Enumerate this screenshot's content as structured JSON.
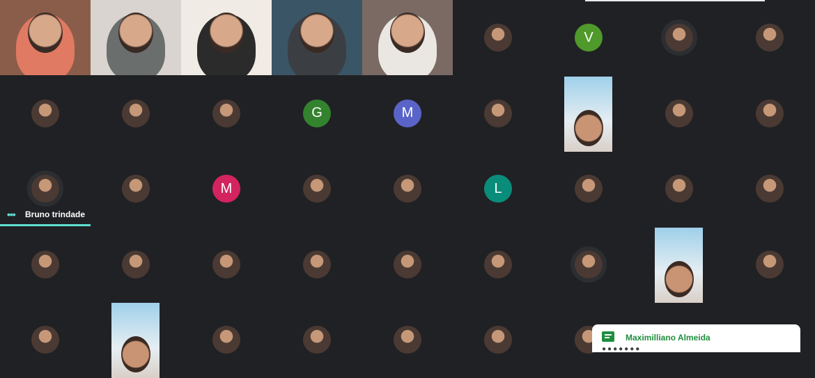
{
  "meeting": {
    "active_speaker": "Bruno trindade"
  },
  "video_tiles": [
    {
      "bg": "#8a5d4a",
      "shirt": "#e07a62"
    },
    {
      "bg": "#d9d4cf",
      "shirt": "#6a6f6e"
    },
    {
      "bg": "#f0ebe4",
      "shirt": "#2b2b2b"
    },
    {
      "bg": "#3a5566",
      "shirt": "#3b3f44"
    },
    {
      "bg": "#7a6a63",
      "shirt": "#eae7e2"
    }
  ],
  "participants": [
    {
      "row": 0,
      "col": 5,
      "kind": "photo"
    },
    {
      "row": 0,
      "col": 6,
      "kind": "letter",
      "initial": "V",
      "color": "#4f9a2b"
    },
    {
      "row": 0,
      "col": 7,
      "kind": "photo",
      "halo": true
    },
    {
      "row": 0,
      "col": 8,
      "kind": "photo"
    },
    {
      "row": 1,
      "col": 0,
      "kind": "photo"
    },
    {
      "row": 1,
      "col": 1,
      "kind": "photo"
    },
    {
      "row": 1,
      "col": 2,
      "kind": "photo"
    },
    {
      "row": 1,
      "col": 3,
      "kind": "letter",
      "initial": "G",
      "color": "#33822e"
    },
    {
      "row": 1,
      "col": 4,
      "kind": "letter",
      "initial": "M",
      "color": "#5a64c8"
    },
    {
      "row": 1,
      "col": 5,
      "kind": "photo"
    },
    {
      "row": 1,
      "col": 7,
      "kind": "photo"
    },
    {
      "row": 1,
      "col": 8,
      "kind": "photo"
    },
    {
      "row": 2,
      "col": 0,
      "kind": "photo",
      "halo": true
    },
    {
      "row": 2,
      "col": 1,
      "kind": "photo"
    },
    {
      "row": 2,
      "col": 2,
      "kind": "letter",
      "initial": "M",
      "color": "#d3245f"
    },
    {
      "row": 2,
      "col": 3,
      "kind": "photo"
    },
    {
      "row": 2,
      "col": 4,
      "kind": "photo"
    },
    {
      "row": 2,
      "col": 5,
      "kind": "letter",
      "initial": "L",
      "color": "#0a8c7a"
    },
    {
      "row": 2,
      "col": 6,
      "kind": "photo"
    },
    {
      "row": 2,
      "col": 7,
      "kind": "photo"
    },
    {
      "row": 2,
      "col": 8,
      "kind": "photo"
    },
    {
      "row": 3,
      "col": 0,
      "kind": "photo"
    },
    {
      "row": 3,
      "col": 1,
      "kind": "photo"
    },
    {
      "row": 3,
      "col": 2,
      "kind": "photo"
    },
    {
      "row": 3,
      "col": 3,
      "kind": "photo"
    },
    {
      "row": 3,
      "col": 4,
      "kind": "photo"
    },
    {
      "row": 3,
      "col": 5,
      "kind": "photo"
    },
    {
      "row": 3,
      "col": 6,
      "kind": "photo",
      "halo": true
    },
    {
      "row": 3,
      "col": 8,
      "kind": "photo"
    },
    {
      "row": 4,
      "col": 0,
      "kind": "photo"
    },
    {
      "row": 4,
      "col": 2,
      "kind": "photo"
    },
    {
      "row": 4,
      "col": 3,
      "kind": "photo"
    },
    {
      "row": 4,
      "col": 4,
      "kind": "photo"
    },
    {
      "row": 4,
      "col": 5,
      "kind": "photo"
    },
    {
      "row": 4,
      "col": 6,
      "kind": "photo"
    }
  ],
  "portraits": [
    {
      "row": 1,
      "col": 6
    },
    {
      "row": 3,
      "col": 7
    },
    {
      "row": 4,
      "col": 1
    }
  ],
  "notification": {
    "icon": "chat-icon",
    "sender": "Maximilliano Almeida",
    "message": "●●●●●●●"
  }
}
